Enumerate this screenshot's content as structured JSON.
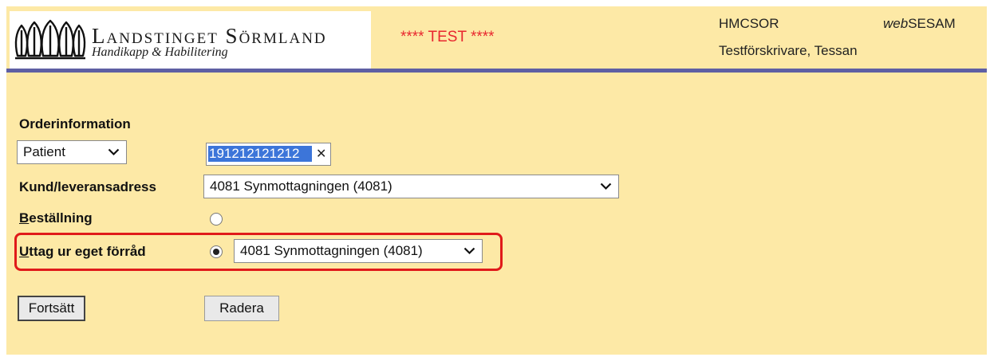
{
  "header": {
    "org_name": "Landstinget Sörmland",
    "org_sub": "Handikapp & Habilitering",
    "test_banner": "**** TEST ****",
    "user_code": "HMCSOR",
    "app_name_prefix": "web",
    "app_name_suffix": "SESAM",
    "user_name": "Testförskrivare, Tessan"
  },
  "form": {
    "section_title": "Orderinformation",
    "id_type_select": {
      "value": "Patient"
    },
    "id_input": {
      "value": "191212121212"
    },
    "customer_label": "Kund/leveransadress",
    "customer_select": {
      "value": "4081 Synmottagningen (4081)"
    },
    "order_label_first": "B",
    "order_label_rest": "eställning",
    "order_radio_checked": false,
    "own_stock_label_first": "U",
    "own_stock_label_rest": "ttag ur eget förråd",
    "own_stock_radio_checked": true,
    "own_stock_select": {
      "value": "4081 Synmottagningen (4081)"
    }
  },
  "buttons": {
    "continue_label": "Fortsätt",
    "delete_label": "Radera"
  },
  "icons": {
    "logo": "landstinget-crown-logo-icon",
    "dropdown": "chevron-down-icon",
    "clear": "close-icon"
  },
  "colors": {
    "background": "#fde9a6",
    "header_rule": "#5e5fa3",
    "test_banner": "#e8272f",
    "highlight_border": "#e01a1a",
    "selection": "#3c75d9"
  }
}
